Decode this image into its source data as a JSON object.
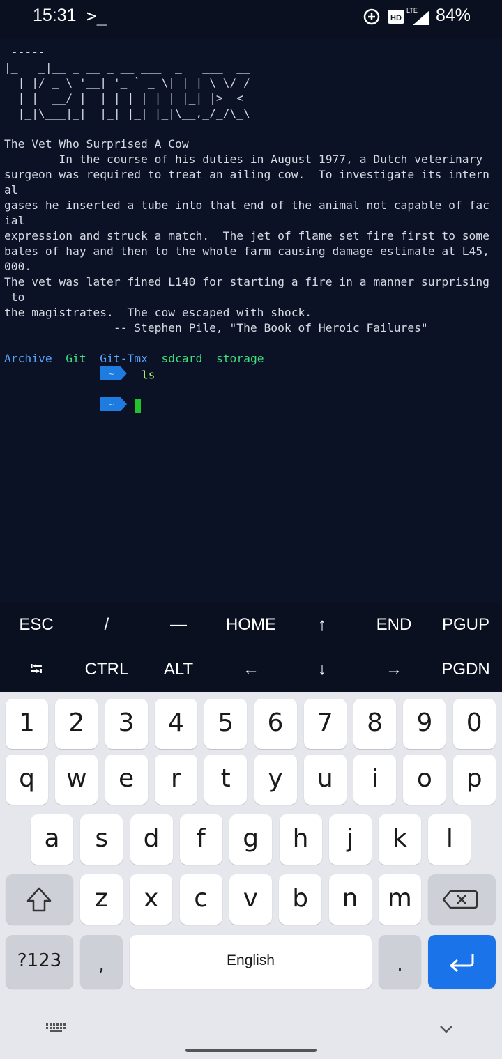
{
  "status_bar": {
    "time": "15:31",
    "terminal_indicator": ">_",
    "network": "LTE",
    "hd_badge": "HD",
    "battery": "84%"
  },
  "terminal": {
    "banner": [
      " -----",
      "|_   _|__ _ __ _ __ ___  _   ___  __",
      "  | |/ _ \\ '__| '_ ` _ \\| | | \\ \\/ /",
      "  | |  __/ |  | | | | | | |_| |>  <",
      "  |_|\\___|_|  |_| |_| |_|\\__,_/_/\\_\\"
    ],
    "fortune": [
      "The Vet Who Surprised A Cow",
      "        In the course of his duties in August 1977, a Dutch veterinary",
      "surgeon was required to treat an ailing cow.  To investigate its intern",
      "al",
      "gases he inserted a tube into that end of the animal not capable of fac",
      "ial",
      "expression and struck a match.  The jet of flame set fire first to some",
      "bales of hay and then to the whole farm causing damage estimate at L45,",
      "000.",
      "The vet was later fined L140 for starting a fire in a manner surprising",
      " to",
      "the magistrates.  The cow escaped with shock.",
      "                -- Stephen Pile, \"The Book of Heroic Failures\""
    ],
    "prompt_symbol": "~",
    "command": "ls",
    "listing": [
      {
        "name": "Archive",
        "color": "#5aa6ff"
      },
      {
        "name": "Git",
        "color": "#3fe07b"
      },
      {
        "name": "Git-Tmx",
        "color": "#5aa6ff"
      },
      {
        "name": "sdcard",
        "color": "#3fe07b"
      },
      {
        "name": "storage",
        "color": "#3fe07b"
      }
    ]
  },
  "extra_keys": {
    "row1": [
      "ESC",
      "/",
      "—",
      "HOME",
      "↑",
      "END",
      "PGUP"
    ],
    "row2": [
      "⭾",
      "CTRL",
      "ALT",
      "←",
      "↓",
      "→",
      "PGDN"
    ]
  },
  "keyboard": {
    "numbers": [
      "1",
      "2",
      "3",
      "4",
      "5",
      "6",
      "7",
      "8",
      "9",
      "0"
    ],
    "row_q": [
      "q",
      "w",
      "e",
      "r",
      "t",
      "y",
      "u",
      "i",
      "o",
      "p"
    ],
    "row_a": [
      "a",
      "s",
      "d",
      "f",
      "g",
      "h",
      "j",
      "k",
      "l"
    ],
    "row_z": [
      "z",
      "x",
      "c",
      "v",
      "b",
      "n",
      "m"
    ],
    "symbols_label": "?123",
    "comma": ",",
    "space_label": "English",
    "period": ".",
    "accent_color": "#1a73e8"
  }
}
